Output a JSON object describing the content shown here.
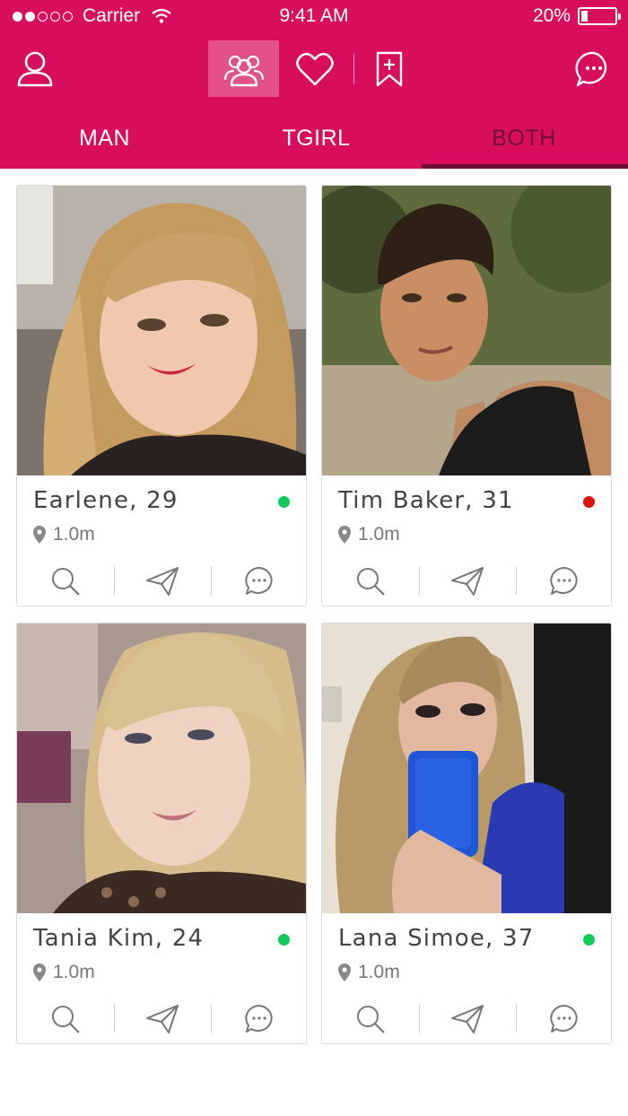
{
  "status_bar": {
    "carrier": "Carrier",
    "time": "9:41 AM",
    "battery": "20%",
    "battery_level": 0.2,
    "signal_bars_full": 2,
    "signal_bars_total": 5
  },
  "toolbar": {
    "icons": [
      "profile-icon",
      "users-icon",
      "heart-icon",
      "bookmark-add-icon",
      "chat-icon"
    ],
    "active": "users-icon"
  },
  "tabs": {
    "items": [
      "MAN",
      "TGIRL",
      "BOTH"
    ],
    "selected": "BOTH"
  },
  "colors": {
    "brand": "#d80d5e",
    "selected_tab": "#6e1033",
    "online": "#14c95b",
    "busy": "#e01010"
  },
  "cards": [
    {
      "name": "Earlene, 29",
      "distance": "1.0m",
      "status": "online"
    },
    {
      "name": "Tim Baker, 31",
      "distance": "1.0m",
      "status": "busy"
    },
    {
      "name": "Tania Kim, 24",
      "distance": "1.0m",
      "status": "online"
    },
    {
      "name": "Lana Simoe, 37",
      "distance": "1.0m",
      "status": "online"
    }
  ],
  "card_actions": [
    "search-icon",
    "send-icon",
    "chat-icon"
  ]
}
